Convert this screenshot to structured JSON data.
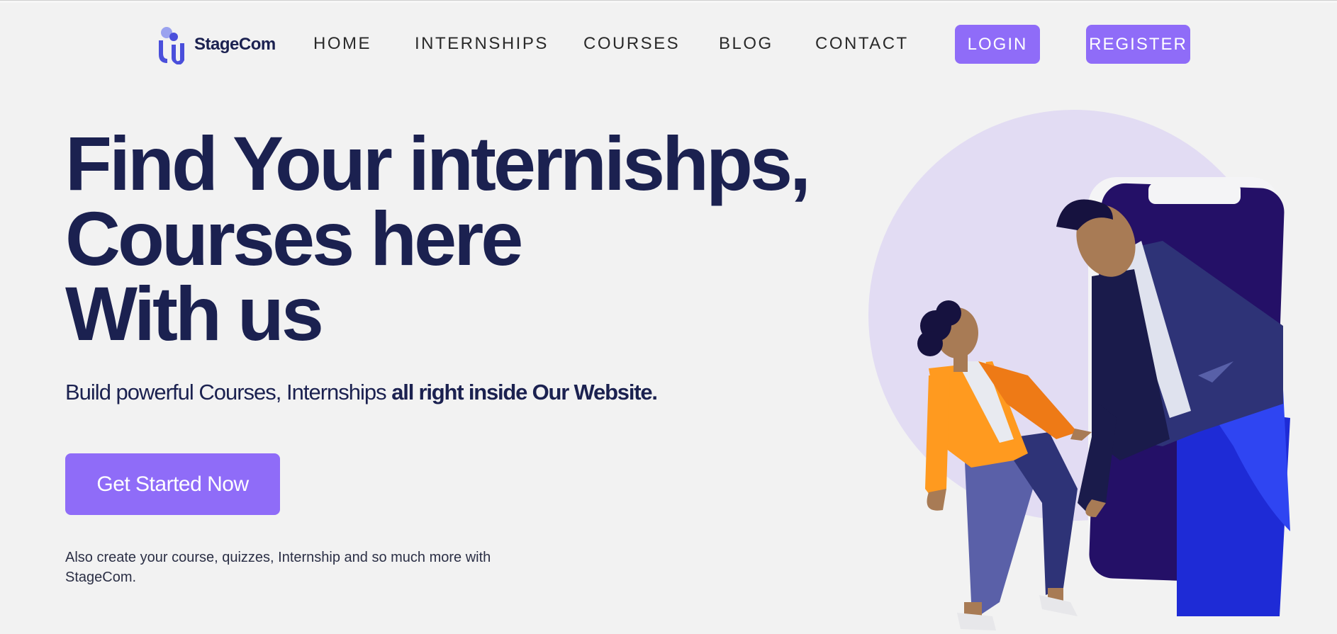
{
  "brand": {
    "name": "StageCom"
  },
  "nav": {
    "links": [
      "HOME",
      "INTERNSHIPS",
      "COURSES",
      "BLOG",
      "CONTACT"
    ],
    "login_label": "LOGIN",
    "register_label": "REGISTER"
  },
  "hero": {
    "title_lines": [
      "Find Your internishps,",
      "Courses here",
      "With us"
    ],
    "subtitle_regular": "Build powerful Courses, Internships ",
    "subtitle_bold": "all right inside Our Website.",
    "cta_label": "Get Started Now",
    "footnote": "Also create your course, quizzes, Internship and so much more with StageCom."
  },
  "colors": {
    "background": "#f2f2f2",
    "accent": "#8f6cf8",
    "heading": "#1b2150"
  },
  "icons": {
    "logo": "stagecom-logo-icon",
    "illustration": "people-phone-illustration"
  }
}
